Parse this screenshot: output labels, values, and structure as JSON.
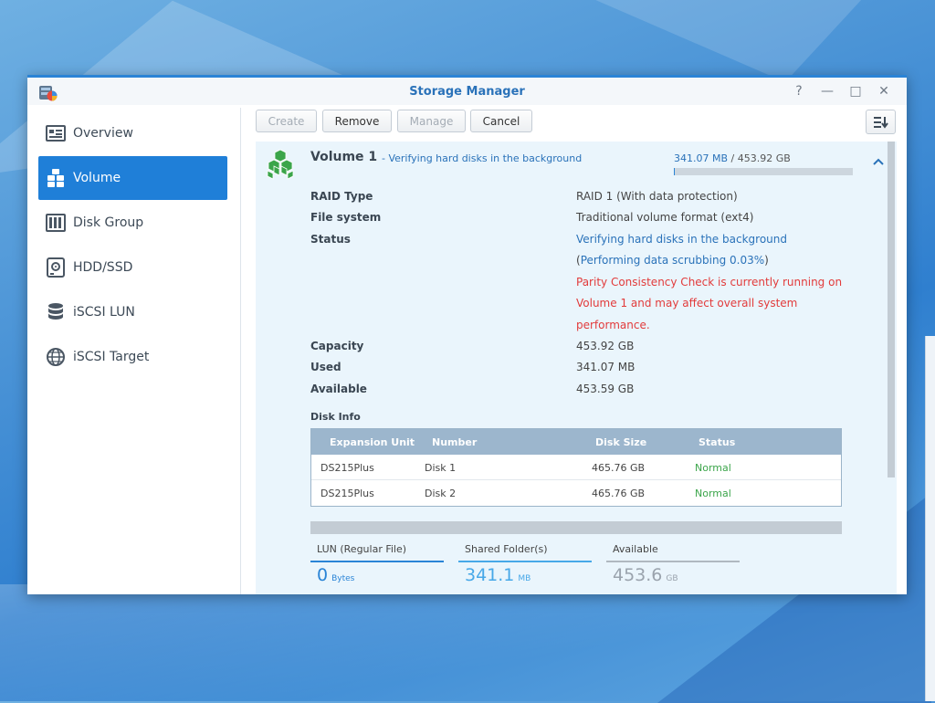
{
  "window": {
    "title": "Storage Manager",
    "controls": {
      "help": "?",
      "minimize": "—",
      "maximize": "□",
      "close": "✕"
    }
  },
  "sidebar": {
    "items": [
      {
        "label": "Overview",
        "icon": "overview-icon",
        "active": false
      },
      {
        "label": "Volume",
        "icon": "volume-cubes-icon",
        "active": true
      },
      {
        "label": "Disk Group",
        "icon": "disk-group-icon",
        "active": false
      },
      {
        "label": "HDD/SSD",
        "icon": "hdd-icon",
        "active": false
      },
      {
        "label": "iSCSI LUN",
        "icon": "database-icon",
        "active": false
      },
      {
        "label": "iSCSI Target",
        "icon": "globe-icon",
        "active": false
      }
    ]
  },
  "toolbar": {
    "create": "Create",
    "remove": "Remove",
    "manage": "Manage",
    "cancel": "Cancel",
    "sort_icon": "sort-icon"
  },
  "volume": {
    "name": "Volume 1",
    "status_line": "- Verifying hard disks in the background",
    "used": "341.07 MB",
    "separator": "/",
    "total": "453.92 GB",
    "used_fraction": 0.0007,
    "properties": [
      {
        "label": "RAID Type",
        "value": "RAID 1 (With data protection)"
      },
      {
        "label": "File system",
        "value": "Traditional volume format (ext4)"
      },
      {
        "label": "Status",
        "value": "Verifying hard disks in the background"
      }
    ],
    "status_detail": {
      "open": "(",
      "scrub": "Performing data scrubbing 0.03%",
      "close": ")",
      "warning": [
        "Parity Consistency Check is currently running on",
        "Volume 1 and may affect overall system",
        "performance."
      ]
    },
    "capacity": [
      {
        "label": "Capacity",
        "value": "453.92 GB"
      },
      {
        "label": "Used",
        "value": "341.07 MB"
      },
      {
        "label": "Available",
        "value": "453.59 GB"
      }
    ]
  },
  "disk_info": {
    "title": "Disk Info",
    "columns": [
      "Expansion Unit",
      "Number",
      "Disk Size",
      "Status"
    ],
    "rows": [
      [
        "DS215Plus",
        "Disk 1",
        "465.76 GB",
        "Normal"
      ],
      [
        "DS215Plus",
        "Disk 2",
        "465.76 GB",
        "Normal"
      ]
    ]
  },
  "usage": {
    "lun": {
      "label": "LUN (Regular File)",
      "value": "0",
      "unit": "Bytes"
    },
    "shared": {
      "label": "Shared Folder(s)",
      "value": "341.1",
      "unit": "MB"
    },
    "available": {
      "label": "Available",
      "value": "453.6",
      "unit": "GB"
    }
  },
  "colors": {
    "accent": "#1f7fd8",
    "title_blue": "#2a72b9",
    "warning_red": "#e23b3b",
    "normal_green": "#3ba54a",
    "panel_bg": "#eaf5fc"
  }
}
